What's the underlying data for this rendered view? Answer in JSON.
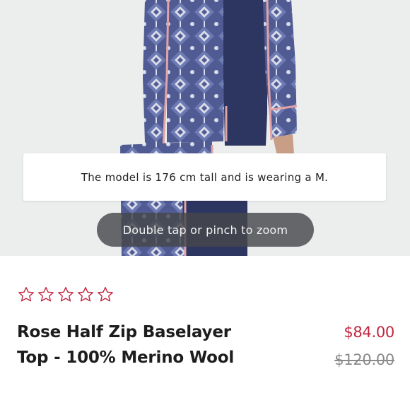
{
  "product_image": {
    "model_note": "The model is 176 cm tall and is wearing a M.",
    "zoom_hint": "Double tap or pinch to zoom",
    "colors": {
      "navy": "#2d3660",
      "pattern_blue": "#5866a0",
      "pattern_light": "#d9dcea",
      "piping_pink": "#e2a3a6",
      "background": "#eceeee"
    }
  },
  "product": {
    "rating": {
      "value": 0,
      "max": 5,
      "star_color": "#c2243e"
    },
    "title": "Rose Half Zip Baselayer Top - 100% Merino Wool",
    "price": "$84.00",
    "original_price": "$120.00"
  }
}
